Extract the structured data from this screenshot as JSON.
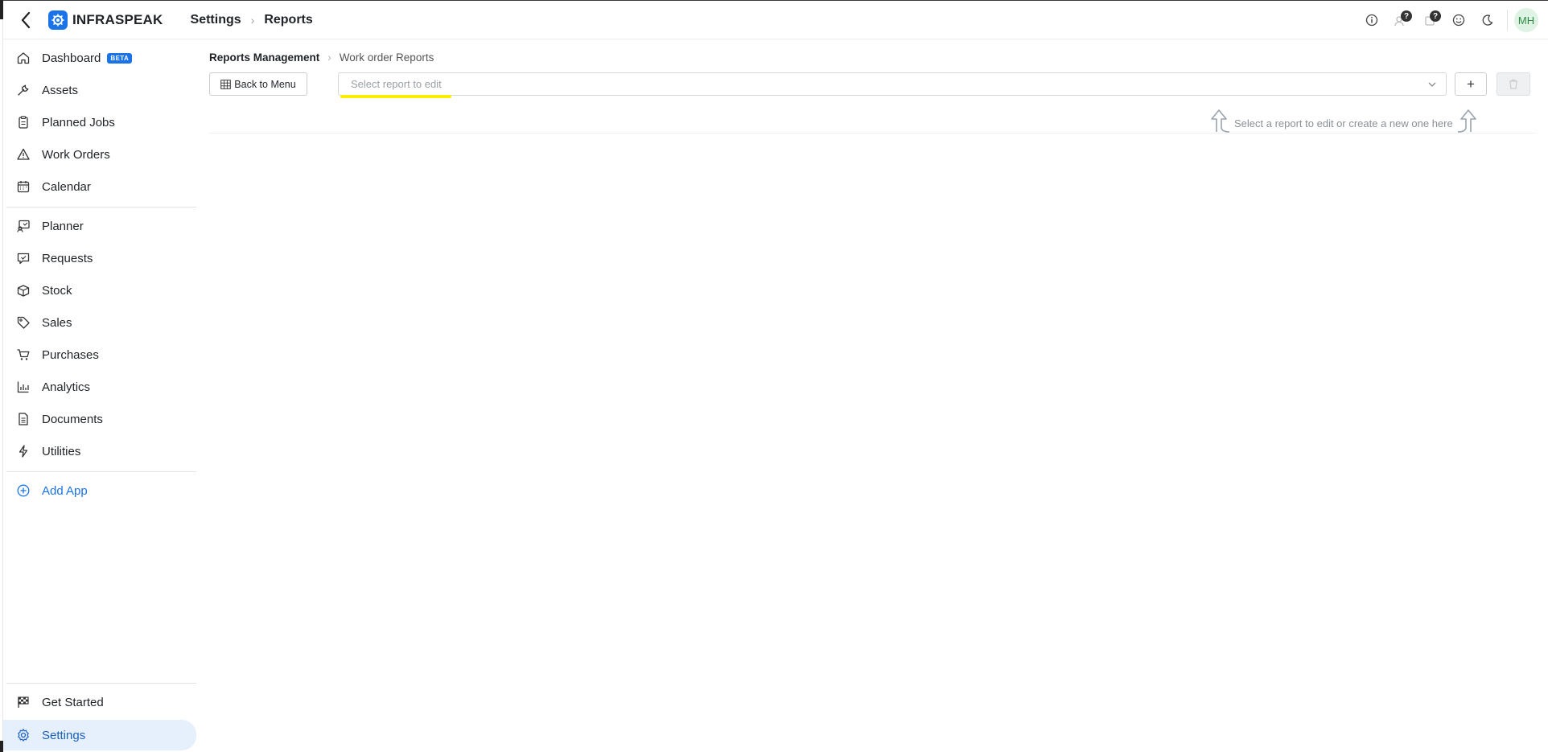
{
  "header": {
    "logo_text": "INFRASPEAK",
    "breadcrumb_settings": "Settings",
    "breadcrumb_reports": "Reports",
    "badge_1": "?",
    "badge_2": "?",
    "avatar_initials": "MH"
  },
  "sidebar": {
    "items": [
      {
        "label": "Dashboard",
        "icon": "home-icon",
        "badge": "BETA"
      },
      {
        "label": "Assets",
        "icon": "wrench-icon"
      },
      {
        "label": "Planned Jobs",
        "icon": "clipboard-icon"
      },
      {
        "label": "Work Orders",
        "icon": "warning-triangle-icon"
      },
      {
        "label": "Calendar",
        "icon": "calendar-icon"
      },
      {
        "label": "Planner",
        "icon": "planner-icon"
      },
      {
        "label": "Requests",
        "icon": "request-check-icon"
      },
      {
        "label": "Stock",
        "icon": "box-icon"
      },
      {
        "label": "Sales",
        "icon": "tag-icon"
      },
      {
        "label": "Purchases",
        "icon": "cart-icon"
      },
      {
        "label": "Analytics",
        "icon": "bar-chart-icon"
      },
      {
        "label": "Documents",
        "icon": "document-icon"
      },
      {
        "label": "Utilities",
        "icon": "lightning-icon"
      }
    ],
    "add_app": "Add App",
    "get_started": "Get Started",
    "settings": "Settings"
  },
  "main": {
    "breadcrumb_root": "Reports Management",
    "breadcrumb_current": "Work order Reports",
    "back_to_menu": "Back to Menu",
    "select_placeholder": "Select report to edit",
    "add_button": "+",
    "hint": "Select a report to edit or create a new one here"
  },
  "colors": {
    "accent": "#1a73e8",
    "highlight": "#ffee00",
    "active_bg": "#e6f0fc"
  }
}
